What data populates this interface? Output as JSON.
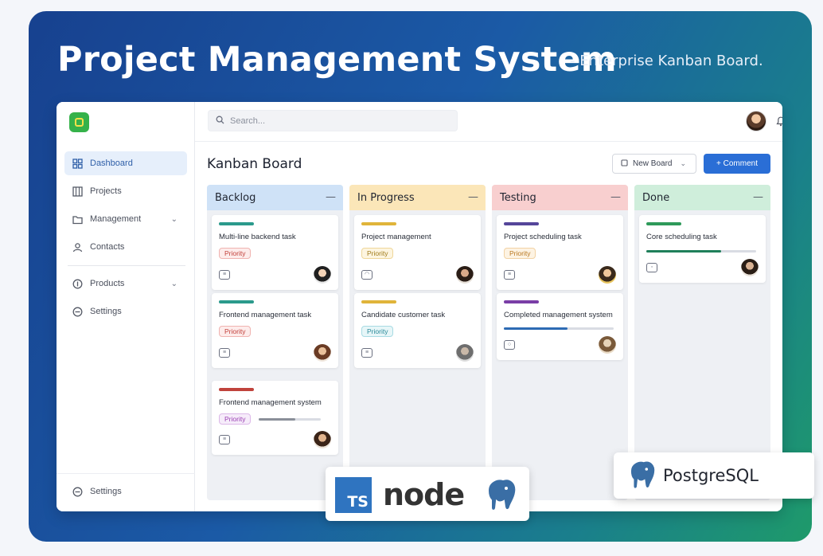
{
  "hero": {
    "title": "Project Management System",
    "subtitle": "- Enterprise Kanban Board."
  },
  "colors": {
    "accent": "#2a6ed6",
    "backlog": "#cfe2f7",
    "in_progress": "#fbe6b8",
    "testing": "#f8cfcf",
    "done": "#cfeedb"
  },
  "sidebar": {
    "items": [
      {
        "label": "Dashboard",
        "icon": "grid-icon",
        "active": true
      },
      {
        "label": "Projects",
        "icon": "board-icon"
      },
      {
        "label": "Management",
        "icon": "folder-icon",
        "expandable": true
      },
      {
        "label": "Contacts",
        "icon": "user-icon"
      },
      {
        "label": "Products",
        "icon": "circle-icon",
        "expandable": true
      },
      {
        "label": "Settings",
        "icon": "gear-icon"
      }
    ],
    "footer_label": "Settings"
  },
  "topbar": {
    "search_placeholder": "Search..."
  },
  "board": {
    "title": "Kanban Board",
    "new_board_label": "New Board",
    "primary_label": "+ Comment",
    "columns": [
      {
        "title": "Backlog",
        "cards": [
          {
            "title": "Multi-line backend task",
            "tag": "Priority"
          },
          {
            "title": "Frontend management task",
            "tag": "Priority"
          },
          {
            "title": "Frontend management system",
            "tag": "Priority"
          }
        ]
      },
      {
        "title": "In Progress",
        "cards": [
          {
            "title": "Project management",
            "tag": "Priority"
          },
          {
            "title": "Candidate customer task",
            "tag": "Priority"
          }
        ]
      },
      {
        "title": "Testing",
        "cards": [
          {
            "title": "Project scheduling task",
            "tag": "Priority"
          },
          {
            "title": "Completed management system"
          }
        ]
      },
      {
        "title": "Done",
        "cards": [
          {
            "title": "Core scheduling task"
          }
        ]
      }
    ]
  },
  "tech": {
    "ts_label": "TS",
    "node_label": "node",
    "pg_label": "PostgreSQL"
  }
}
